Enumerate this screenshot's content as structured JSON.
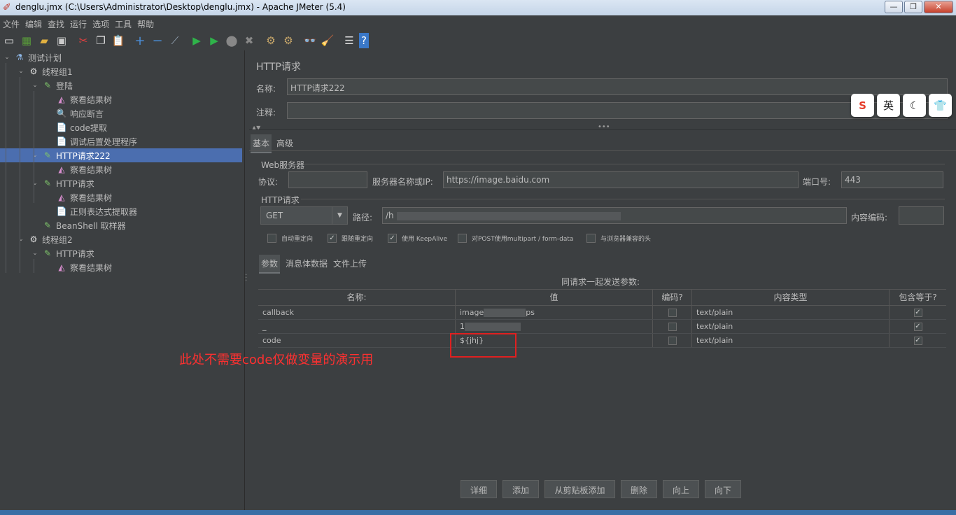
{
  "window": {
    "title": "denglu.jmx (C:\\Users\\Administrator\\Desktop\\denglu.jmx) - Apache JMeter (5.4)",
    "minimize": "—",
    "maximize": "❐",
    "close": "✕"
  },
  "menu": [
    "文件",
    "编辑",
    "查找",
    "运行",
    "选项",
    "工具",
    "帮助"
  ],
  "toolbar": [
    "new-icon",
    "templates-icon",
    "open-icon",
    "save-icon",
    "cut-icon",
    "copy-icon",
    "paste-icon",
    "expand-icon",
    "collapse-icon",
    "toggle-icon",
    "start-icon",
    "start-no-pause-icon",
    "stop-icon",
    "shutdown-icon",
    "clear-icon",
    "clear-all-icon",
    "search-icon",
    "reset-search-icon",
    "function-helper-icon",
    "help-icon"
  ],
  "tree": [
    {
      "label": "测试计划",
      "level": 0,
      "toggle": "⌄",
      "icon": "test-plan-icon",
      "glyph": "⚗"
    },
    {
      "label": "线程组1",
      "level": 1,
      "toggle": "⌄",
      "icon": "thread-group-icon",
      "glyph": "⚙"
    },
    {
      "label": "登陆",
      "level": 2,
      "toggle": "⌄",
      "icon": "sampler-icon",
      "glyph": "✎"
    },
    {
      "label": "察看结果树",
      "level": 3,
      "toggle": "",
      "icon": "listener-icon",
      "glyph": "◭"
    },
    {
      "label": "响应断言",
      "level": 3,
      "toggle": "",
      "icon": "assertion-icon",
      "glyph": "🔍"
    },
    {
      "label": "code提取",
      "level": 3,
      "toggle": "",
      "icon": "extractor-icon",
      "glyph": "📄"
    },
    {
      "label": "调试后置处理程序",
      "level": 3,
      "toggle": "",
      "icon": "postprocessor-icon",
      "glyph": "📄"
    },
    {
      "label": "HTTP请求222",
      "level": 2,
      "toggle": "⌄",
      "icon": "sampler-icon",
      "glyph": "✎",
      "selected": true
    },
    {
      "label": "察看结果树",
      "level": 3,
      "toggle": "",
      "icon": "listener-icon",
      "glyph": "◭"
    },
    {
      "label": "HTTP请求",
      "level": 2,
      "toggle": "⌄",
      "icon": "sampler-icon",
      "glyph": "✎"
    },
    {
      "label": "察看结果树",
      "level": 3,
      "toggle": "",
      "icon": "listener-icon",
      "glyph": "◭"
    },
    {
      "label": "正则表达式提取器",
      "level": 3,
      "toggle": "",
      "icon": "extractor-icon",
      "glyph": "📄"
    },
    {
      "label": "BeanShell 取样器",
      "level": 2,
      "toggle": "",
      "icon": "sampler-icon",
      "glyph": "✎"
    },
    {
      "label": "线程组2",
      "level": 1,
      "toggle": "⌄",
      "icon": "thread-group-icon",
      "glyph": "⚙"
    },
    {
      "label": "HTTP请求",
      "level": 2,
      "toggle": "⌄",
      "icon": "sampler-icon",
      "glyph": "✎"
    },
    {
      "label": "察看结果树",
      "level": 3,
      "toggle": "",
      "icon": "listener-icon",
      "glyph": "◭"
    }
  ],
  "panel": {
    "title": "HTTP请求",
    "name_label": "名称:",
    "name_value": "HTTP请求222",
    "comment_label": "注释:",
    "comment_value": "",
    "tabs": [
      "基本",
      "高级"
    ],
    "web_server_title": "Web服务器",
    "protocol_label": "协议:",
    "protocol_value": "",
    "server_label": "服务器名称或IP:",
    "server_value": "https://image.baidu.com",
    "port_label": "端口号:",
    "port_value": "443",
    "http_title": "HTTP请求",
    "method": "GET",
    "path_label": "路径:",
    "path_value": "/h",
    "encoding_label": "内容编码:",
    "encoding_value": "",
    "checkboxes": [
      {
        "label": "自动重定向",
        "checked": false
      },
      {
        "label": "跟随重定向",
        "checked": true
      },
      {
        "label": "使用 KeepAlive",
        "checked": true
      },
      {
        "label": "对POST使用multipart / form-data",
        "checked": false
      },
      {
        "label": "与浏览器兼容的头",
        "checked": false
      }
    ],
    "subtabs": [
      "参数",
      "消息体数据",
      "文件上传"
    ],
    "table_caption": "同请求一起发送参数:",
    "columns": [
      "名称:",
      "值",
      "编码?",
      "内容类型",
      "包含等于?"
    ],
    "rows": [
      {
        "name": "callback",
        "value_a": "image",
        "value_b": "ps",
        "encode": false,
        "type": "text/plain",
        "include": true
      },
      {
        "name": "_",
        "value_a": "1",
        "value_b": "",
        "encode": false,
        "type": "text/plain",
        "include": true
      },
      {
        "name": "code",
        "value_a": "${jhj}",
        "value_b": "",
        "encode": false,
        "type": "text/plain",
        "include": true
      }
    ],
    "buttons": [
      "详细",
      "添加",
      "从剪贴板添加",
      "删除",
      "向上",
      "向下"
    ]
  },
  "annotation": "此处不需要code仅做变量的演示用",
  "ime": [
    "S",
    "英",
    "☾",
    "👕"
  ],
  "check_glyph": "✓",
  "colors": {
    "selection": "#4b6eaf",
    "annotation": "#ff3030",
    "background": "#3c3f41"
  }
}
